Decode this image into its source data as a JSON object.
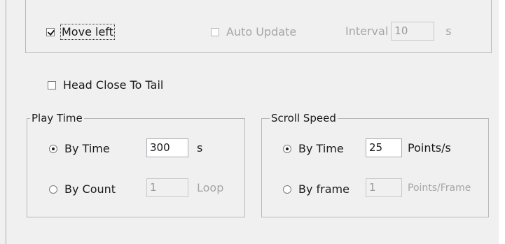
{
  "top": {
    "move_left": {
      "label": "Move left",
      "checked": true
    },
    "auto_update": {
      "label": "Auto Update",
      "checked": false,
      "enabled": false
    },
    "interval": {
      "label": "Interval",
      "value": "10",
      "unit": "s"
    }
  },
  "head_close_to_tail": {
    "label": "Head Close To Tail",
    "checked": false
  },
  "play_time": {
    "title": "Play Time",
    "by_time": {
      "label": "By Time",
      "selected": true,
      "value": "300",
      "unit": "s"
    },
    "by_count": {
      "label": "By Count",
      "selected": false,
      "value": "1",
      "unit": "Loop"
    }
  },
  "scroll_speed": {
    "title": "Scroll Speed",
    "by_time": {
      "label": "By Time",
      "selected": true,
      "value": "25",
      "unit": "Points/s"
    },
    "by_frame": {
      "label": "By frame",
      "selected": false,
      "value": "1",
      "unit": "Points/Frame"
    }
  },
  "colors": {
    "panel": "#f0f0f0",
    "border": "#b8b8b8",
    "disabled_text": "#a6a6a6"
  }
}
